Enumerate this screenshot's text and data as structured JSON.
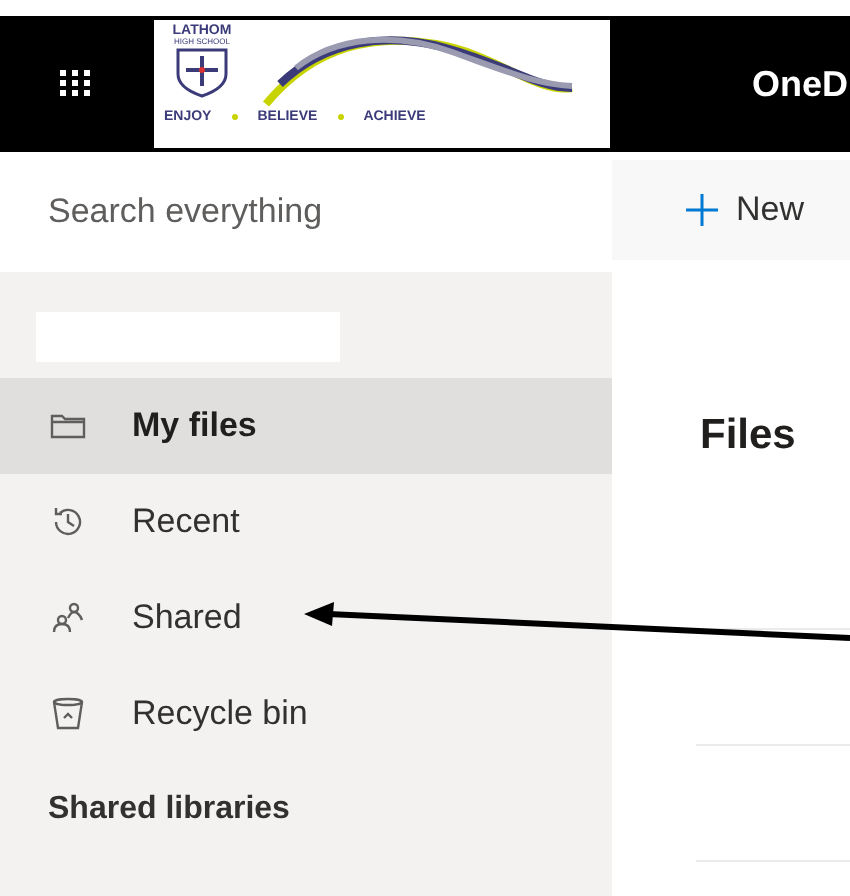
{
  "header": {
    "logo": {
      "name": "LATHOM",
      "subtitle": "HIGH SCHOOL",
      "motto": [
        "ENJOY",
        "BELIEVE",
        "ACHIEVE"
      ]
    },
    "app_title": "OneD"
  },
  "search": {
    "placeholder": "Search everything"
  },
  "toolbar": {
    "new_button": "New"
  },
  "sidebar": {
    "items": [
      {
        "label": "My files",
        "kind": "folder",
        "selected": true
      },
      {
        "label": "Recent",
        "kind": "history",
        "selected": false
      },
      {
        "label": "Shared",
        "kind": "people",
        "selected": false
      },
      {
        "label": "Recycle bin",
        "kind": "bin",
        "selected": false
      }
    ],
    "section_heading": "Shared libraries"
  },
  "main": {
    "title": "Files"
  }
}
